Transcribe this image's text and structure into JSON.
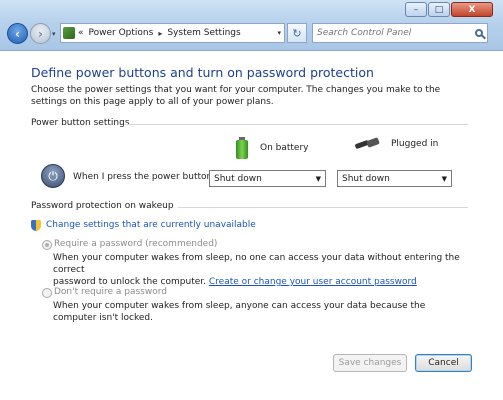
{
  "window": {
    "minimize": "–",
    "maximize": "□",
    "close": "X"
  },
  "nav": {
    "back": "‹",
    "forward": "›",
    "dropdown": "▾"
  },
  "address": {
    "prefix": "«",
    "crumbs": [
      "Power Options",
      "System Settings"
    ],
    "separator": "▸",
    "dropdown": "▾"
  },
  "refresh": "↻",
  "search": {
    "placeholder": "Search Control Panel"
  },
  "page": {
    "title": "Define power buttons and turn on password protection",
    "description": "Choose the power settings that you want for your computer. The changes you make to the settings on this page apply to all of your power plans."
  },
  "power_buttons": {
    "section_label": "Power button settings",
    "col_battery": "On battery",
    "col_plugged": "Plugged in",
    "row_label": "When I press the power button:",
    "battery_value": "Shut down",
    "plugged_value": "Shut down"
  },
  "password": {
    "section_label": "Password protection on wakeup",
    "change_link": "Change settings that are currently unavailable",
    "require": {
      "label": "Require a password (recommended)",
      "desc_1": "When your computer wakes from sleep, no one can access your data without entering the correct",
      "desc_2": "password to unlock the computer.",
      "link": "Create or change your user account password"
    },
    "no_require": {
      "label": "Don't require a password",
      "desc": "When your computer wakes from sleep, anyone can access your data because the computer isn't locked."
    }
  },
  "buttons": {
    "save": "Save changes",
    "cancel": "Cancel"
  }
}
